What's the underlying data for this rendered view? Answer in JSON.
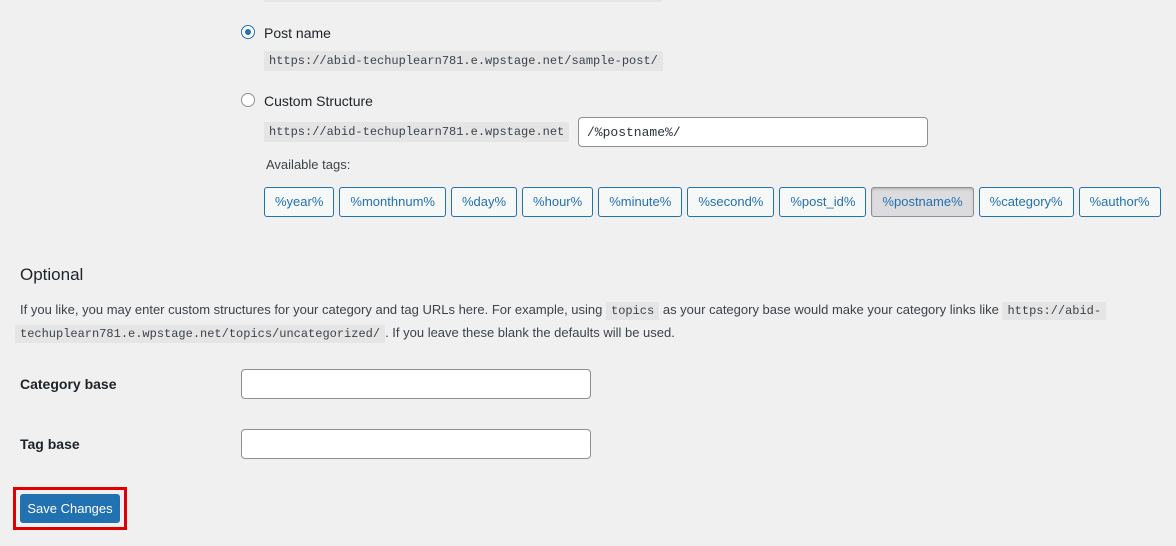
{
  "permalink_options": {
    "post_name": {
      "label": "Post name",
      "example_url": "https://abid-techuplearn781.e.wpstage.net/sample-post/",
      "selected": true
    },
    "custom_structure": {
      "label": "Custom Structure",
      "base_url": "https://abid-techuplearn781.e.wpstage.net",
      "value": "/%postname%/",
      "selected": false
    }
  },
  "available_tags": {
    "label": "Available tags:",
    "tags": [
      "%year%",
      "%monthnum%",
      "%day%",
      "%hour%",
      "%minute%",
      "%second%",
      "%post_id%",
      "%postname%",
      "%category%",
      "%author%"
    ],
    "active_tag": "%postname%"
  },
  "optional": {
    "title": "Optional",
    "description_part1": "If you like, you may enter custom structures for your category and tag URLs here. For example, using",
    "description_code1": "topics",
    "description_part2": "as your category base would make your category links like",
    "description_code2a": "https://abid-",
    "description_code2b": "techuplearn781.e.wpstage.net/topics/uncategorized/",
    "description_part3": ". If you leave these blank the defaults will be used."
  },
  "fields": {
    "category_base": {
      "label": "Category base",
      "value": ""
    },
    "tag_base": {
      "label": "Tag base",
      "value": ""
    }
  },
  "actions": {
    "save_label": "Save Changes"
  },
  "colors": {
    "accent": "#2271b1",
    "highlight_border": "#e00000",
    "background": "#f0f0f1"
  }
}
